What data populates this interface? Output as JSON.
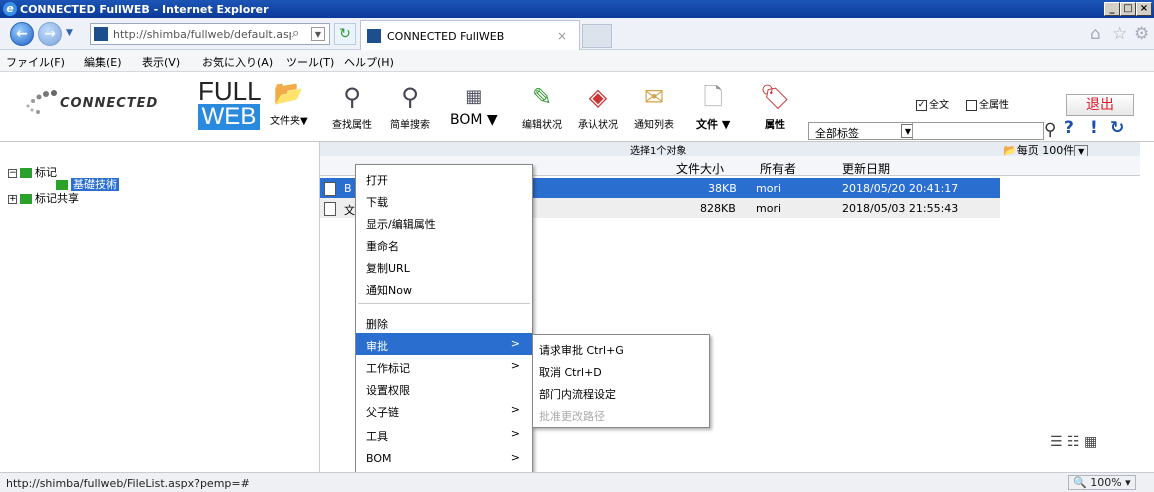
{
  "window": {
    "title": "CONNECTED FullWEB - Internet Explorer"
  },
  "nav": {
    "address": "http://shimba/fullweb/default.aspx?w",
    "tab_label": "CONNECTED FullWEB",
    "tab_close": "×"
  },
  "menubar": [
    "ファイル(F)",
    "編集(E)",
    "表示(V)",
    "お気に入り(A)",
    "ツール(T)",
    "ヘルプ(H)"
  ],
  "logo": {
    "text": "CONNECTED",
    "full": "FULL",
    "web": "WEB"
  },
  "toolbar": {
    "folder": "文件夹▼",
    "find_attr": "查找属性",
    "simple_search": "简单搜索",
    "bom": "BOM ▼",
    "edit_status": "编辑状况",
    "approve_status": "承认状况",
    "notify_list": "通知列表",
    "file": "文件 ▼",
    "attribute": "属性",
    "tag_select": "全部标签",
    "fulltext": "全文",
    "allattr": "全属性",
    "fulltext_checked": true,
    "allattr_checked": false,
    "logout": "退出"
  },
  "tree": {
    "root": "标记",
    "child_selected": "基礎技術",
    "shared": "标记共享"
  },
  "list": {
    "selected_count": "选择1个对象",
    "per_page": "每页 100件",
    "headers": {
      "size": "文件大小",
      "owner": "所有者",
      "updated": "更新日期"
    },
    "rows": [
      {
        "prefix": "B",
        "size": "38KB",
        "owner": "mori",
        "updated": "2018/05/20 20:41:17"
      },
      {
        "prefix": "文",
        "size": "828KB",
        "owner": "mori",
        "updated": "2018/05/03 21:55:43"
      }
    ]
  },
  "context_menu": [
    {
      "label": "打开",
      "arrow": false
    },
    {
      "label": "下载",
      "arrow": false
    },
    {
      "label": "显示/编辑属性",
      "arrow": false
    },
    {
      "label": "重命名",
      "arrow": false
    },
    {
      "label": "复制URL",
      "arrow": false
    },
    {
      "label": "通知Now",
      "arrow": false
    },
    {
      "label": "删除",
      "arrow": false
    },
    {
      "label": "审批",
      "arrow": true
    },
    {
      "label": "工作标记",
      "arrow": true
    },
    {
      "label": "设置权限",
      "arrow": false
    },
    {
      "label": "父子链",
      "arrow": true
    },
    {
      "label": "工具",
      "arrow": true
    },
    {
      "label": "BOM",
      "arrow": true
    }
  ],
  "submenu": [
    {
      "label": "请求审批 Ctrl+G",
      "disabled": false
    },
    {
      "label": "取消 Ctrl+D",
      "disabled": false
    },
    {
      "label": "部门内流程设定",
      "disabled": false
    },
    {
      "label": "批准更改路径",
      "disabled": true
    }
  ],
  "status": {
    "url": "http://shimba/fullweb/FileList.aspx?pemp=#",
    "zoom": "100%"
  },
  "colors": {
    "accent": "#2a6fd0",
    "titlebar": "#1d55b6",
    "logout": "#e0192b",
    "tree_green": "#2aa12a"
  }
}
